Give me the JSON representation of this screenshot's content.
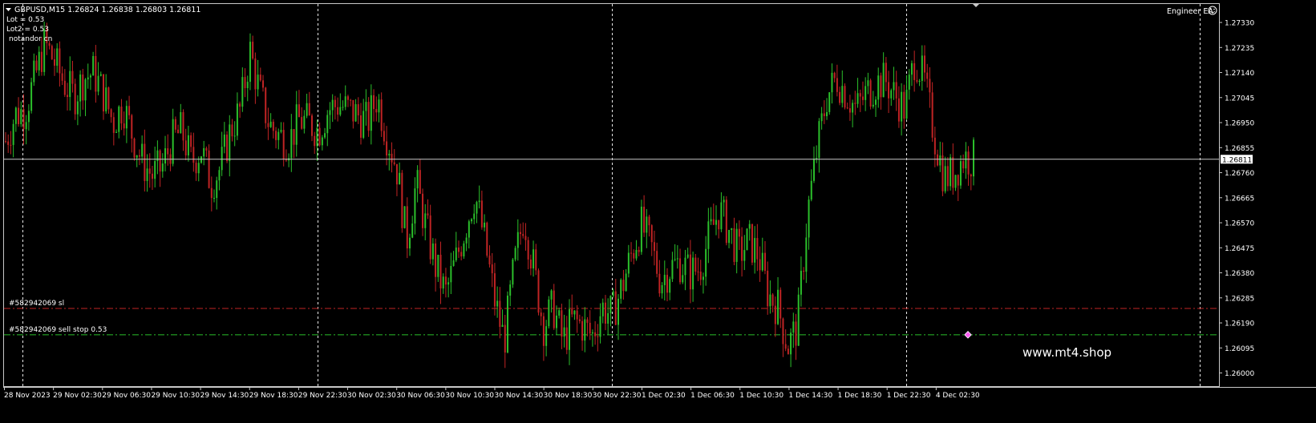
{
  "header": {
    "symbol_line": "GBPUSD,M15  1.26824 1.26838 1.26803 1.26811",
    "info_lines": [
      "Lot = 0.53",
      "Lot2 = 0.53",
      "notandor cn"
    ]
  },
  "ea_label": "Engineer EA",
  "watermark": "www.mt4.shop",
  "order_labels": {
    "sl": "#582942069 sl",
    "sell_stop": "#582942069 sell stop 0.53"
  },
  "price_tag": "1.26811",
  "colors": {
    "background": "#000000",
    "bull": "#2bbf2b",
    "bear": "#c02424",
    "grid": "#ffffff",
    "sl_line": "#c02424",
    "entry_line": "#2bbf2b",
    "marker": "#ff5cf2"
  },
  "chart_data": {
    "type": "candlestick",
    "symbol": "GBPUSD",
    "timeframe": "M15",
    "ylim": [
      1.2595,
      1.274
    ],
    "y_ticks": [
      "1.27330",
      "1.27235",
      "1.27140",
      "1.27045",
      "1.26950",
      "1.26855",
      "1.26760",
      "1.26665",
      "1.26570",
      "1.26475",
      "1.26380",
      "1.26285",
      "1.26190",
      "1.26095",
      "1.26000"
    ],
    "x_ticks": [
      "28 Nov 2023",
      "29 Nov 02:30",
      "29 Nov 06:30",
      "29 Nov 10:30",
      "29 Nov 14:30",
      "29 Nov 18:30",
      "29 Nov 22:30",
      "30 Nov 02:30",
      "30 Nov 06:30",
      "30 Nov 10:30",
      "30 Nov 14:30",
      "30 Nov 18:30",
      "30 Nov 22:30",
      "1 Dec 02:30",
      "1 Dec 06:30",
      "1 Dec 10:30",
      "1 Dec 14:30",
      "1 Dec 18:30",
      "1 Dec 22:30",
      "4 Dec 02:30"
    ],
    "current_price": 1.26811,
    "sl_price": 1.26245,
    "entry_price": 1.26145,
    "close_path": [
      1.2688,
      1.2698,
      1.27,
      1.2712,
      1.2725,
      1.2718,
      1.271,
      1.2705,
      1.2712,
      1.2714,
      1.2706,
      1.2695,
      1.2702,
      1.269,
      1.268,
      1.2675,
      1.2678,
      1.2688,
      1.2692,
      1.268,
      1.2685,
      1.2672,
      1.2678,
      1.2692,
      1.27,
      1.2722,
      1.2706,
      1.2694,
      1.269,
      1.2688,
      1.2696,
      1.2695,
      1.2692,
      1.27,
      1.2702,
      1.27,
      1.2698,
      1.2695,
      1.2705,
      1.269,
      1.2678,
      1.265,
      1.2672,
      1.2655,
      1.264,
      1.263,
      1.2642,
      1.2655,
      1.2668,
      1.265,
      1.2628,
      1.2612,
      1.264,
      1.266,
      1.264,
      1.2618,
      1.2625,
      1.2612,
      1.262,
      1.2618,
      1.2614,
      1.2625,
      1.2622,
      1.2632,
      1.2645,
      1.2656,
      1.2648,
      1.2635,
      1.264,
      1.2642,
      1.2638,
      1.264,
      1.2652,
      1.2662,
      1.2654,
      1.2645,
      1.265,
      1.2645,
      1.263,
      1.2625,
      1.261,
      1.2618,
      1.266,
      1.2685,
      1.2705,
      1.2712,
      1.2706,
      1.27,
      1.2706,
      1.271,
      1.2711,
      1.2705,
      1.27,
      1.272,
      1.271,
      1.269,
      1.2674,
      1.2676,
      1.2682,
      1.2681
    ]
  }
}
